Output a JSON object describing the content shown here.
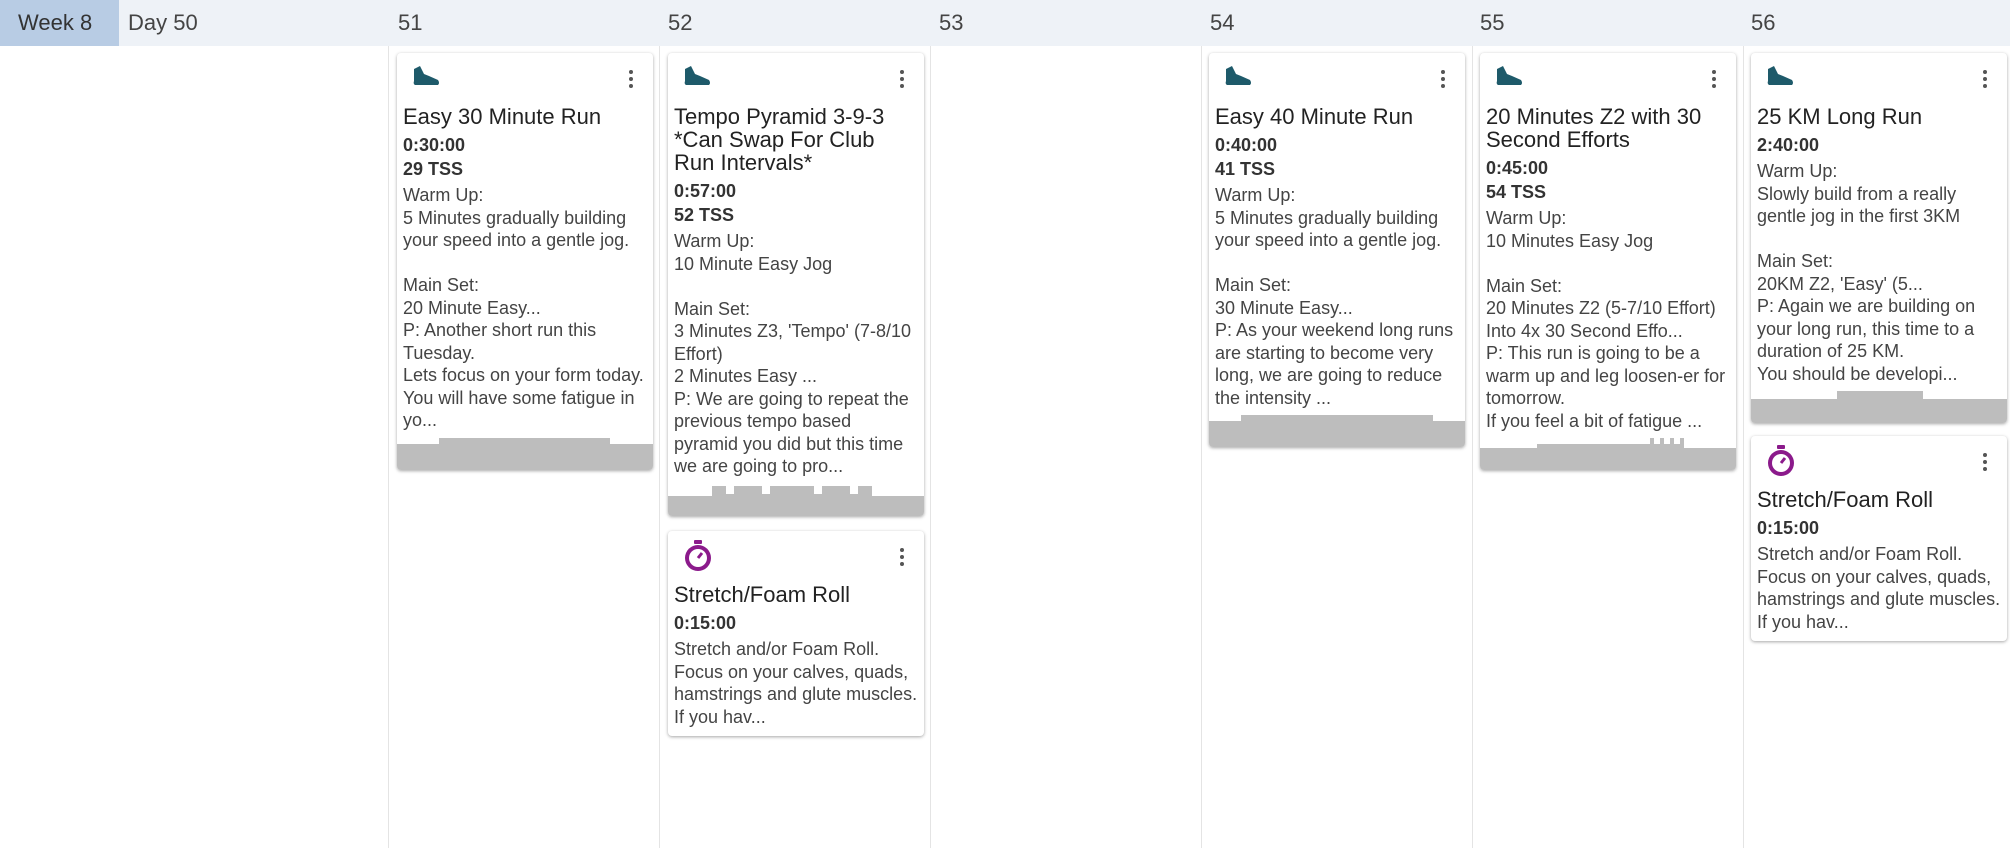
{
  "header": {
    "week_label": "Week 8",
    "days": [
      "Day 50",
      "51",
      "52",
      "53",
      "54",
      "55",
      "56"
    ]
  },
  "colors": {
    "run_icon": "#1e5a6a",
    "stretch_icon": "#8b1a8b",
    "profile_bar": "#bdbdbd",
    "header_bg": "#eef2f7",
    "week_bg": "#b8cce4"
  },
  "workouts": [
    {
      "day": "51",
      "icon": "shoe-icon",
      "title": "Easy 30 Minute Run",
      "duration": "0:30:00",
      "tss": "29 TSS",
      "description": "Warm Up:\n5 Minutes gradually building your speed into a gentle jog.\n\nMain Set:\n20 Minute Easy...\nP: Another short run this Tuesday.\nLets focus on your form today. You will have some fatigue in yo..."
    },
    {
      "day": "52",
      "icon": "shoe-icon",
      "title": "Tempo Pyramid 3-9-3 *Can Swap For Club Run Intervals*",
      "duration": "0:57:00",
      "tss": "52 TSS",
      "description": "Warm Up:\n10 Minute Easy Jog\n\nMain Set:\n3 Minutes Z3, 'Tempo' (7-8/10 Effort)\n2 Minutes Easy ...\nP: We are going to repeat the previous tempo based pyramid you did but this time we are going to pro..."
    },
    {
      "day": "52",
      "icon": "stopwatch-icon",
      "title": "Stretch/Foam Roll",
      "duration": "0:15:00",
      "description": "Stretch and/or Foam Roll. Focus on your calves, quads, hamstrings and glute muscles.\nIf you hav..."
    },
    {
      "day": "54",
      "icon": "shoe-icon",
      "title": "Easy 40 Minute Run",
      "duration": "0:40:00",
      "tss": "41 TSS",
      "description": "Warm Up:\n5 Minutes gradually building your speed into a gentle jog.\n\nMain Set:\n30 Minute Easy...\nP: As your weekend long runs are starting to become very long, we are going to reduce the intensity ..."
    },
    {
      "day": "55",
      "icon": "shoe-icon",
      "title": "20 Minutes Z2 with 30 Second Efforts",
      "duration": "0:45:00",
      "tss": "54 TSS",
      "description": "Warm Up:\n10 Minutes Easy Jog\n\nMain Set:\n20 Minutes Z2 (5-7/10 Effort)\nInto 4x 30 Second Effo...\nP: This run is going to be a warm up and leg loosen-er for tomorrow.\nIf you feel a bit of fatigue ..."
    },
    {
      "day": "56",
      "icon": "shoe-icon",
      "title": "25 KM Long Run",
      "duration": "2:40:00",
      "description": "Warm Up:\nSlowly build from a really gentle jog in the first 3KM\n\nMain Set:\n20KM Z2, 'Easy' (5...\nP: Again we are building on your long run, this time to a duration of 25 KM.\nYou should be developi..."
    },
    {
      "day": "56",
      "icon": "stopwatch-icon",
      "title": "Stretch/Foam Roll",
      "duration": "0:15:00",
      "description": "Stretch and/or Foam Roll. Focus on your calves, quads, hamstrings and glute muscles.\nIf you hav..."
    }
  ]
}
